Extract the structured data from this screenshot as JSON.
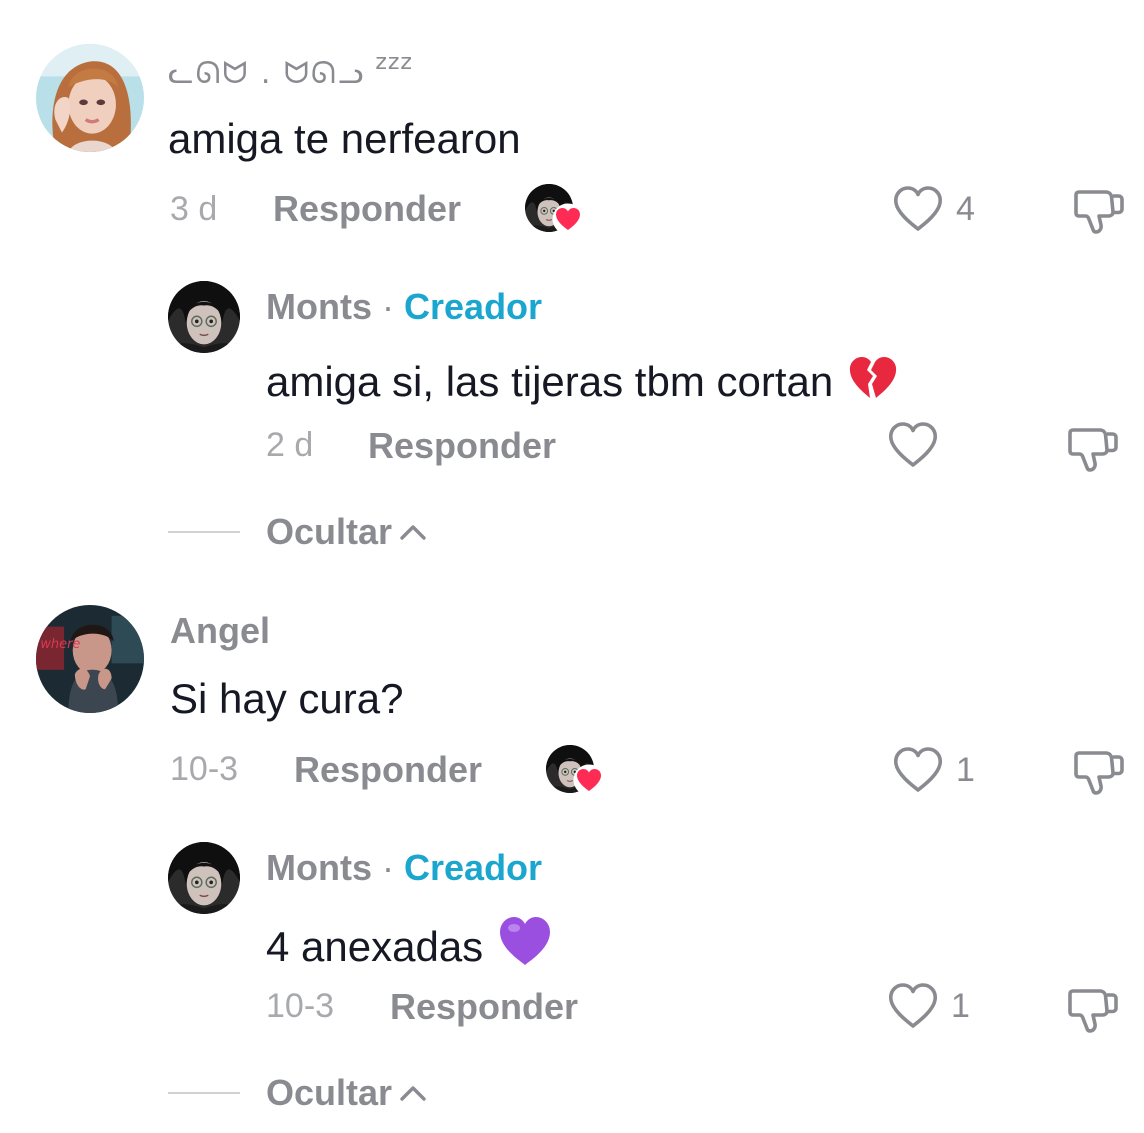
{
  "comments": [
    {
      "username": "ᓚᘏᗢ . ᗢᘏᓗ",
      "username_suffix": "zzz",
      "text": "amiga te nerfearon",
      "time": "3 d",
      "reply_label": "Responder",
      "likes": "4",
      "liked_by_creator": true,
      "replies": [
        {
          "username": "Monts",
          "separator": "·",
          "badge": "Creador",
          "text": "amiga si, las tijeras tbm cortan",
          "emoji": "broken-heart-icon",
          "time": "2 d",
          "reply_label": "Responder",
          "likes": ""
        }
      ],
      "hide_label": "Ocultar"
    },
    {
      "username": "Angel",
      "text": "Si hay cura?",
      "time": "10-3",
      "reply_label": "Responder",
      "likes": "1",
      "liked_by_creator": true,
      "replies": [
        {
          "username": "Monts",
          "separator": "·",
          "badge": "Creador",
          "text": "4 anexadas",
          "emoji": "purple-heart-icon",
          "time": "10-3",
          "reply_label": "Responder",
          "likes": "1"
        }
      ],
      "hide_label": "Ocultar"
    }
  ],
  "colors": {
    "creator_badge": "#1aa6cf",
    "secondary_text": "#8a8b91",
    "primary_text": "#161823",
    "like_badge_heart": "#fe2c55",
    "broken_heart": "#e8283e",
    "purple_heart": "#9b4fe0"
  }
}
